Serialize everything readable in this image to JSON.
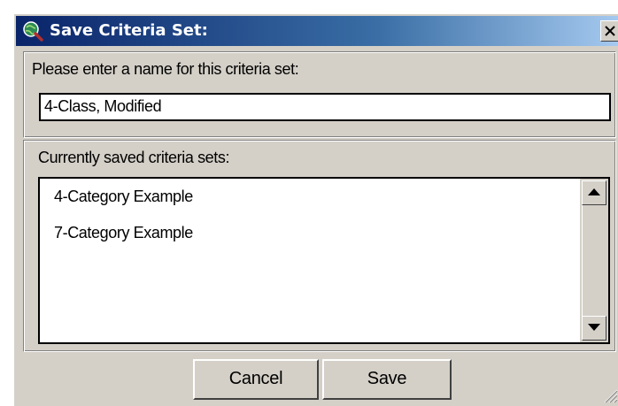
{
  "dialog": {
    "title": "Save Criteria Set:",
    "title_icon": "globe-magnifier-icon",
    "close_icon": "close-icon"
  },
  "name_section": {
    "label": "Please enter a name for this criteria set:",
    "input_value": "4-Class, Modified"
  },
  "saved_section": {
    "label": "Currently saved criteria sets:",
    "items": [
      "4-Category Example",
      "7-Category Example"
    ],
    "scroll_up_icon": "arrow-up-icon",
    "scroll_down_icon": "arrow-down-icon"
  },
  "buttons": {
    "cancel": "Cancel",
    "save": "Save"
  },
  "colors": {
    "titlebar_start": "#0a246a",
    "titlebar_end": "#a6caf0",
    "dialog_face": "#d4d0c8"
  }
}
